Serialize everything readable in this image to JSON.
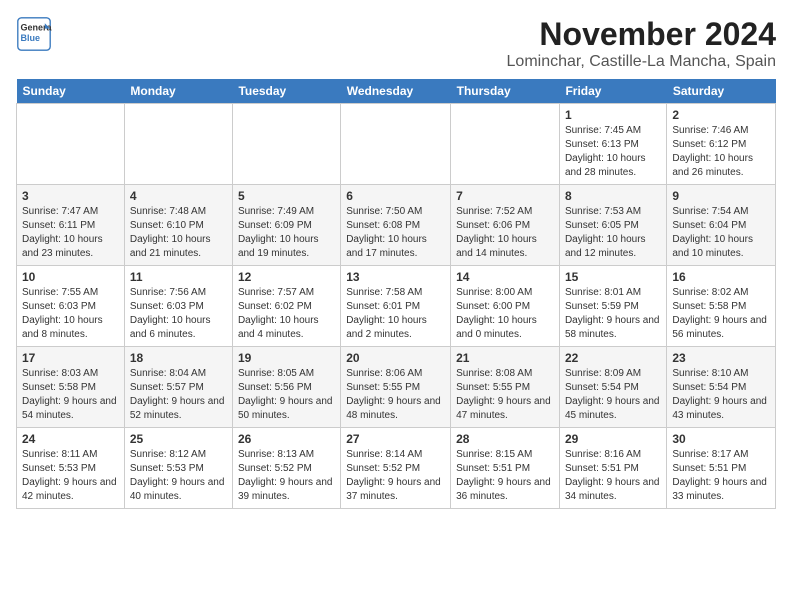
{
  "header": {
    "logo_line1": "General",
    "logo_line2": "Blue",
    "month": "November 2024",
    "location": "Lominchar, Castille-La Mancha, Spain"
  },
  "weekdays": [
    "Sunday",
    "Monday",
    "Tuesday",
    "Wednesday",
    "Thursday",
    "Friday",
    "Saturday"
  ],
  "weeks": [
    [
      {
        "day": "",
        "info": ""
      },
      {
        "day": "",
        "info": ""
      },
      {
        "day": "",
        "info": ""
      },
      {
        "day": "",
        "info": ""
      },
      {
        "day": "",
        "info": ""
      },
      {
        "day": "1",
        "info": "Sunrise: 7:45 AM\nSunset: 6:13 PM\nDaylight: 10 hours and 28 minutes."
      },
      {
        "day": "2",
        "info": "Sunrise: 7:46 AM\nSunset: 6:12 PM\nDaylight: 10 hours and 26 minutes."
      }
    ],
    [
      {
        "day": "3",
        "info": "Sunrise: 7:47 AM\nSunset: 6:11 PM\nDaylight: 10 hours and 23 minutes."
      },
      {
        "day": "4",
        "info": "Sunrise: 7:48 AM\nSunset: 6:10 PM\nDaylight: 10 hours and 21 minutes."
      },
      {
        "day": "5",
        "info": "Sunrise: 7:49 AM\nSunset: 6:09 PM\nDaylight: 10 hours and 19 minutes."
      },
      {
        "day": "6",
        "info": "Sunrise: 7:50 AM\nSunset: 6:08 PM\nDaylight: 10 hours and 17 minutes."
      },
      {
        "day": "7",
        "info": "Sunrise: 7:52 AM\nSunset: 6:06 PM\nDaylight: 10 hours and 14 minutes."
      },
      {
        "day": "8",
        "info": "Sunrise: 7:53 AM\nSunset: 6:05 PM\nDaylight: 10 hours and 12 minutes."
      },
      {
        "day": "9",
        "info": "Sunrise: 7:54 AM\nSunset: 6:04 PM\nDaylight: 10 hours and 10 minutes."
      }
    ],
    [
      {
        "day": "10",
        "info": "Sunrise: 7:55 AM\nSunset: 6:03 PM\nDaylight: 10 hours and 8 minutes."
      },
      {
        "day": "11",
        "info": "Sunrise: 7:56 AM\nSunset: 6:03 PM\nDaylight: 10 hours and 6 minutes."
      },
      {
        "day": "12",
        "info": "Sunrise: 7:57 AM\nSunset: 6:02 PM\nDaylight: 10 hours and 4 minutes."
      },
      {
        "day": "13",
        "info": "Sunrise: 7:58 AM\nSunset: 6:01 PM\nDaylight: 10 hours and 2 minutes."
      },
      {
        "day": "14",
        "info": "Sunrise: 8:00 AM\nSunset: 6:00 PM\nDaylight: 10 hours and 0 minutes."
      },
      {
        "day": "15",
        "info": "Sunrise: 8:01 AM\nSunset: 5:59 PM\nDaylight: 9 hours and 58 minutes."
      },
      {
        "day": "16",
        "info": "Sunrise: 8:02 AM\nSunset: 5:58 PM\nDaylight: 9 hours and 56 minutes."
      }
    ],
    [
      {
        "day": "17",
        "info": "Sunrise: 8:03 AM\nSunset: 5:58 PM\nDaylight: 9 hours and 54 minutes."
      },
      {
        "day": "18",
        "info": "Sunrise: 8:04 AM\nSunset: 5:57 PM\nDaylight: 9 hours and 52 minutes."
      },
      {
        "day": "19",
        "info": "Sunrise: 8:05 AM\nSunset: 5:56 PM\nDaylight: 9 hours and 50 minutes."
      },
      {
        "day": "20",
        "info": "Sunrise: 8:06 AM\nSunset: 5:55 PM\nDaylight: 9 hours and 48 minutes."
      },
      {
        "day": "21",
        "info": "Sunrise: 8:08 AM\nSunset: 5:55 PM\nDaylight: 9 hours and 47 minutes."
      },
      {
        "day": "22",
        "info": "Sunrise: 8:09 AM\nSunset: 5:54 PM\nDaylight: 9 hours and 45 minutes."
      },
      {
        "day": "23",
        "info": "Sunrise: 8:10 AM\nSunset: 5:54 PM\nDaylight: 9 hours and 43 minutes."
      }
    ],
    [
      {
        "day": "24",
        "info": "Sunrise: 8:11 AM\nSunset: 5:53 PM\nDaylight: 9 hours and 42 minutes."
      },
      {
        "day": "25",
        "info": "Sunrise: 8:12 AM\nSunset: 5:53 PM\nDaylight: 9 hours and 40 minutes."
      },
      {
        "day": "26",
        "info": "Sunrise: 8:13 AM\nSunset: 5:52 PM\nDaylight: 9 hours and 39 minutes."
      },
      {
        "day": "27",
        "info": "Sunrise: 8:14 AM\nSunset: 5:52 PM\nDaylight: 9 hours and 37 minutes."
      },
      {
        "day": "28",
        "info": "Sunrise: 8:15 AM\nSunset: 5:51 PM\nDaylight: 9 hours and 36 minutes."
      },
      {
        "day": "29",
        "info": "Sunrise: 8:16 AM\nSunset: 5:51 PM\nDaylight: 9 hours and 34 minutes."
      },
      {
        "day": "30",
        "info": "Sunrise: 8:17 AM\nSunset: 5:51 PM\nDaylight: 9 hours and 33 minutes."
      }
    ]
  ]
}
